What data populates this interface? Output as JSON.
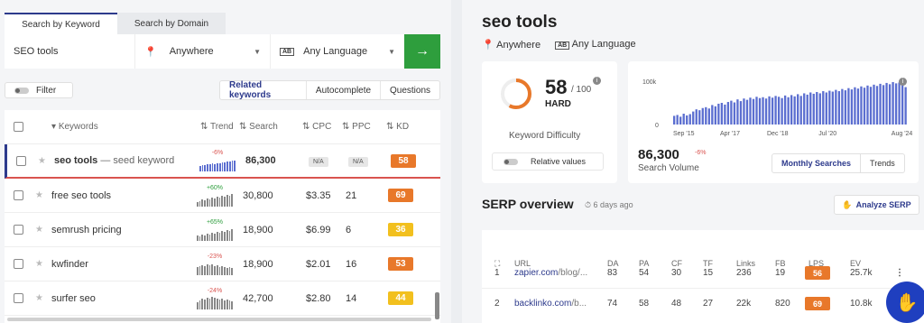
{
  "tabs": {
    "keyword": "Search by Keyword",
    "domain": "Search by Domain"
  },
  "search": {
    "keyword": "SEO tools",
    "location": "Anywhere",
    "language": "Any Language",
    "go": "→",
    "language_icon": "AB"
  },
  "filter": {
    "label": "Filter"
  },
  "view_tabs": [
    "Related keywords",
    "Autocomplete",
    "Questions"
  ],
  "table": {
    "headers": {
      "keywords": "Keywords",
      "trend": "Trend",
      "search": "Search",
      "cpc": "CPC",
      "ppc": "PPC",
      "kd": "KD"
    },
    "rows": [
      {
        "keyword": "seo tools",
        "seed": "— seed keyword",
        "trend_pct": "-6%",
        "trend_dir": "down",
        "search": "86,300",
        "cpc": "N/A",
        "ppc": "N/A",
        "kd": "58",
        "kd_color": "#e8782a"
      },
      {
        "keyword": "free seo tools",
        "trend_pct": "+60%",
        "trend_dir": "up",
        "search": "30,800",
        "cpc": "$3.35",
        "ppc": "21",
        "kd": "69",
        "kd_color": "#e8782a"
      },
      {
        "keyword": "semrush pricing",
        "trend_pct": "+65%",
        "trend_dir": "up",
        "search": "18,900",
        "cpc": "$6.99",
        "ppc": "6",
        "kd": "36",
        "kd_color": "#f2c01e"
      },
      {
        "keyword": "kwfinder",
        "trend_pct": "-23%",
        "trend_dir": "down",
        "search": "18,900",
        "cpc": "$2.01",
        "ppc": "16",
        "kd": "53",
        "kd_color": "#e8782a"
      },
      {
        "keyword": "surfer seo",
        "trend_pct": "-24%",
        "trend_dir": "down",
        "search": "42,700",
        "cpc": "$2.80",
        "ppc": "14",
        "kd": "44",
        "kd_color": "#f2c01e"
      }
    ]
  },
  "detail": {
    "title": "seo tools",
    "location": "Anywhere",
    "language": "Any Language",
    "language_icon": "AB",
    "kd_value": "58",
    "kd_max": "/ 100",
    "kd_level": "HARD",
    "kd_label": "Keyword Difficulty",
    "relative_label": "Relative values",
    "volume": "86,300",
    "volume_pct": "-6%",
    "volume_label": "Search Volume",
    "vol_tabs": [
      "Monthly Searches",
      "Trends"
    ]
  },
  "chart_data": {
    "type": "bar",
    "ylim": [
      0,
      100000
    ],
    "y_ticks": [
      "100k",
      "0"
    ],
    "x_ticks": [
      "Sep '15",
      "Apr '17",
      "Dec '18",
      "Jul '20",
      "Aug '24"
    ],
    "values": [
      20000,
      22000,
      18000,
      25000,
      21000,
      24000,
      30000,
      35000,
      33000,
      38000,
      40000,
      37000,
      45000,
      42000,
      48000,
      50000,
      46000,
      52000,
      55000,
      51000,
      58000,
      54000,
      60000,
      57000,
      62000,
      59000,
      64000,
      61000,
      63000,
      60000,
      65000,
      62000,
      66000,
      64000,
      61000,
      67000,
      63000,
      68000,
      65000,
      70000,
      66000,
      72000,
      69000,
      74000,
      71000,
      75000,
      72000,
      77000,
      74000,
      78000,
      76000,
      80000,
      77000,
      82000,
      79000,
      84000,
      81000,
      86000,
      83000,
      88000,
      85000,
      90000,
      87000,
      92000,
      89000,
      94000,
      91000,
      96000,
      93000,
      98000,
      95000,
      97000,
      93000,
      86300
    ]
  },
  "serp": {
    "title": "SERP overview",
    "ago": "6 days ago",
    "analyze": "Analyze SERP",
    "headers": [
      "URL",
      "DA",
      "PA",
      "CF",
      "TF",
      "Links",
      "FB",
      "LPS",
      "EV"
    ],
    "rows": [
      {
        "n": "1",
        "domain": "zapier.com",
        "path": "/blog/...",
        "da": "83",
        "pa": "54",
        "cf": "30",
        "tf": "15",
        "links": "236",
        "fb": "19",
        "lps": "56",
        "ev": "25.7k"
      },
      {
        "n": "2",
        "domain": "backlinko.com",
        "path": "/b...",
        "da": "74",
        "pa": "58",
        "cf": "48",
        "tf": "27",
        "links": "22k",
        "fb": "820",
        "lps": "69",
        "ev": "10.8k"
      }
    ]
  }
}
